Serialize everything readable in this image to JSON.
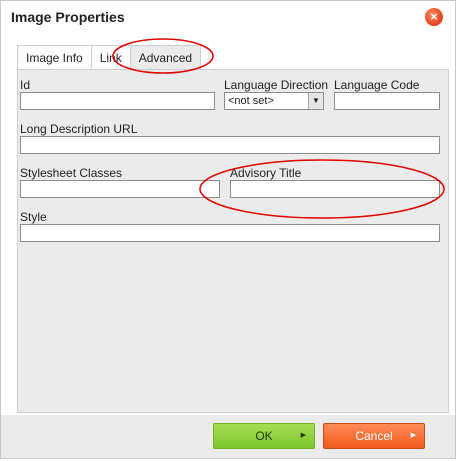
{
  "dialog": {
    "title": "Image Properties",
    "close_glyph": "×"
  },
  "tabs": [
    {
      "label": "Image Info"
    },
    {
      "label": "Link"
    },
    {
      "label": "Advanced"
    }
  ],
  "fields": {
    "id": {
      "label": "Id",
      "value": ""
    },
    "language_direction": {
      "label": "Language Direction",
      "selected": "<not set>"
    },
    "language_code": {
      "label": "Language Code",
      "value": ""
    },
    "long_description_url": {
      "label": "Long Description URL",
      "value": ""
    },
    "stylesheet_classes": {
      "label": "Stylesheet Classes",
      "value": ""
    },
    "advisory_title": {
      "label": "Advisory Title",
      "value": ""
    },
    "style": {
      "label": "Style",
      "value": ""
    }
  },
  "buttons": {
    "ok": "OK",
    "cancel": "Cancel"
  },
  "annotation_color": "#e00000",
  "icons": {
    "close": "close-icon",
    "dropdown": "chevron-down-icon",
    "ok_arrow": "arrow-right-icon",
    "cancel_arrow": "arrow-right-icon"
  }
}
